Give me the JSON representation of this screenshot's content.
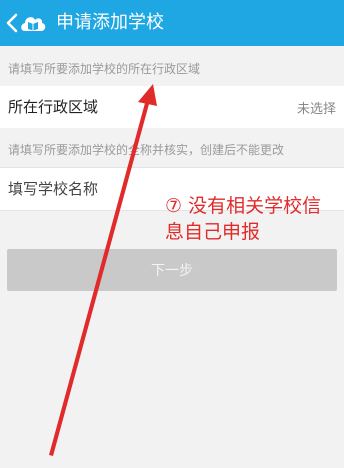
{
  "header": {
    "title": "申请添加学校",
    "accent_color": "#1fa7e3",
    "back_icon": "chevron-left-icon",
    "logo_icon": "cloud-book-icon"
  },
  "form": {
    "region_hint": "请填写所要添加学校的所在行政区域",
    "region_label": "所在行政区域",
    "region_value": "未选择",
    "name_hint": "请填写所要添加学校的全称并核实，创建后不能更改",
    "name_placeholder": "填写学校名称",
    "next_label": "下一步"
  },
  "annotation": {
    "line1": "⑦ 没有相关学校信",
    "line2": "息自己申报",
    "color": "#e12b2b"
  }
}
